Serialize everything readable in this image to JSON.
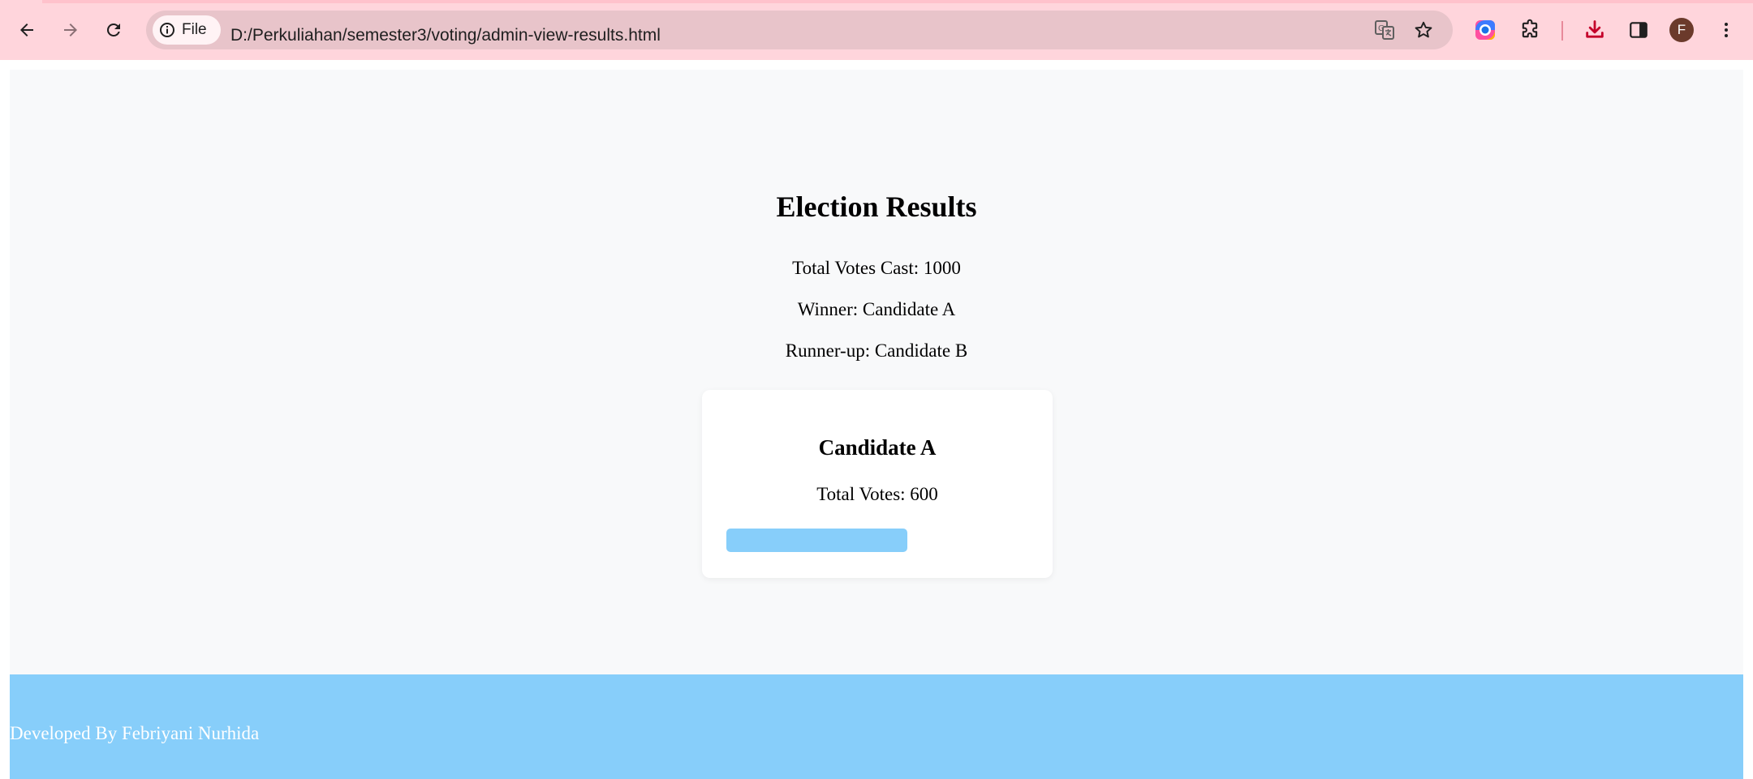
{
  "browser": {
    "site_chip_label": "File",
    "url": "D:/Perkuliahan/semester3/voting/admin-view-results.html",
    "profile_initial": "F"
  },
  "icons": {
    "back": "back-arrow-icon",
    "forward": "forward-arrow-icon",
    "reload": "reload-icon",
    "info": "info-icon",
    "translate": "translate-icon",
    "bookmark": "star-icon",
    "color_extension": "color-wheel-icon",
    "extensions": "puzzle-icon",
    "download": "download-icon",
    "side_panel": "side-panel-icon",
    "menu": "kebab-menu-icon"
  },
  "results": {
    "title": "Election Results",
    "total_votes": "Total Votes Cast: 1000",
    "winner": "Winner: Candidate A",
    "runner_up": "Runner-up: Candidate B"
  },
  "candidates": [
    {
      "name": "Candidate A",
      "votes_text": "Total Votes: 600",
      "bar_fraction": 0.6
    }
  ],
  "footer": {
    "text": "Developed By Febriyani Nurhida"
  },
  "colors": {
    "chrome_bg": "#ffd5dc",
    "omnibox_bg": "#e8c4ca",
    "page_bg": "#f8f9fa",
    "accent": "#87cefa",
    "download_icon": "#c4002a"
  }
}
